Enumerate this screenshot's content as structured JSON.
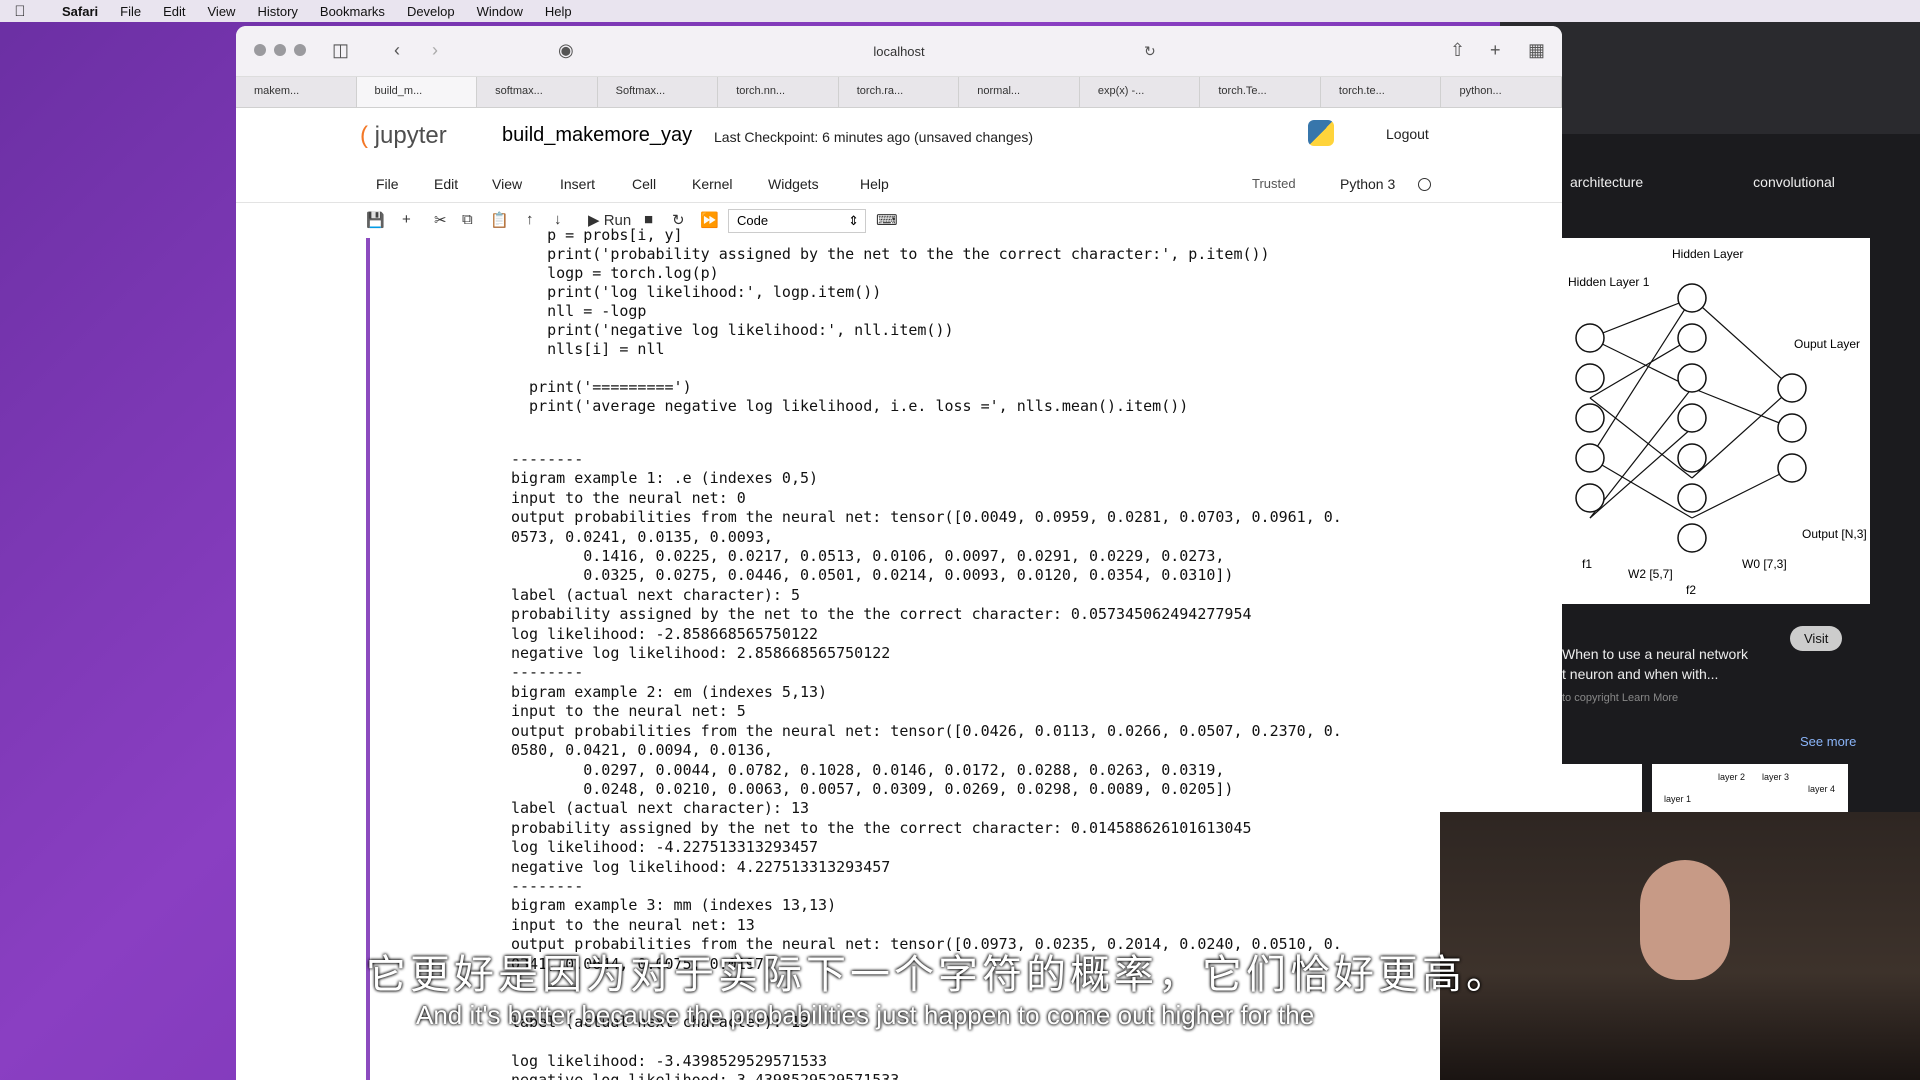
{
  "menubar": {
    "apple": "",
    "app": "Safari",
    "items": [
      "File",
      "Edit",
      "View",
      "History",
      "Bookmarks",
      "Develop",
      "Window",
      "Help"
    ]
  },
  "safari": {
    "url": "localhost",
    "tabs": [
      "makem...",
      "build_m...",
      "softmax...",
      "Softmax...",
      "torch.nn...",
      "torch.ra...",
      "normal...",
      "exp(x) -...",
      "torch.Te...",
      "torch.te...",
      "python..."
    ]
  },
  "jupyter": {
    "logo": "jupyter",
    "notebook": "build_makemore_yay",
    "checkpoint": "Last Checkpoint: 6 minutes ago  (unsaved changes)",
    "logout": "Logout",
    "menu": [
      "File",
      "Edit",
      "View",
      "Insert",
      "Cell",
      "Kernel",
      "Widgets",
      "Help"
    ],
    "trusted": "Trusted",
    "kernel": "Python 3",
    "run": "Run",
    "celltype": "Code"
  },
  "code": "    p = probs[i, y]\n    print('probability assigned by the net to the the correct character:', p.item())\n    logp = torch.log(p)\n    print('log likelihood:', logp.item())\n    nll = -logp\n    print('negative log likelihood:', nll.item())\n    nlls[i] = nll\n\n  print('=========')\n  print('average negative log likelihood, i.e. loss =', nlls.mean().item())",
  "output": "--------\nbigram example 1: .e (indexes 0,5)\ninput to the neural net: 0\noutput probabilities from the neural net: tensor([0.0049, 0.0959, 0.0281, 0.0703, 0.0961, 0.\n0573, 0.0241, 0.0135, 0.0093,\n        0.1416, 0.0225, 0.0217, 0.0513, 0.0106, 0.0097, 0.0291, 0.0229, 0.0273,\n        0.0325, 0.0275, 0.0446, 0.0501, 0.0214, 0.0093, 0.0120, 0.0354, 0.0310])\nlabel (actual next character): 5\nprobability assigned by the net to the the correct character: 0.057345062494277954\nlog likelihood: -2.858668565750122\nnegative log likelihood: 2.858668565750122\n--------\nbigram example 2: em (indexes 5,13)\ninput to the neural net: 5\noutput probabilities from the neural net: tensor([0.0426, 0.0113, 0.0266, 0.0507, 0.2370, 0.\n0580, 0.0421, 0.0094, 0.0136,\n        0.0297, 0.0044, 0.0782, 0.1028, 0.0146, 0.0172, 0.0288, 0.0263, 0.0319,\n        0.0248, 0.0210, 0.0063, 0.0057, 0.0309, 0.0269, 0.0298, 0.0089, 0.0205])\nlabel (actual next character): 13\nprobability assigned by the net to the the correct character: 0.014588626101613045\nlog likelihood: -4.227513313293457\nnegative log likelihood: 4.227513313293457\n--------\nbigram example 3: mm (indexes 13,13)\ninput to the neural net: 13\noutput probabilities from the neural net: tensor([0.0973, 0.0235, 0.2014, 0.0240, 0.0510, 0.\n0341, 0.0644, 0.0075, 0.0197,\n\n\nlabel (actual next character): 13\n\nlog likelihood: -3.4398529529571533\nnegative log likelihood: 3.4398529529571533\n--------",
  "bgpanel": {
    "chip1": "architecture",
    "chip2": "convolutional",
    "diagram_labels": [
      "Hidden Layer 1",
      "Hidden Layer",
      "Ouput Layer",
      "Output [N,3]",
      "f1",
      "W2 [5,7]",
      "f2",
      "W0 [7,3]"
    ],
    "caption1": "When to use a neural network",
    "caption2": "t neuron and when with...",
    "copyright": "to copyright  Learn More",
    "visit": "Visit",
    "seemore": "See more",
    "thumbs": [
      "layer 1",
      "layer 2",
      "layer 3",
      "layer 4"
    ]
  },
  "subtitles": {
    "cn": "它更好是因为对于实际下一个字符的概率，它们恰好更高。",
    "en": "And it's better because the probabilities just happen to come out higher for the"
  }
}
